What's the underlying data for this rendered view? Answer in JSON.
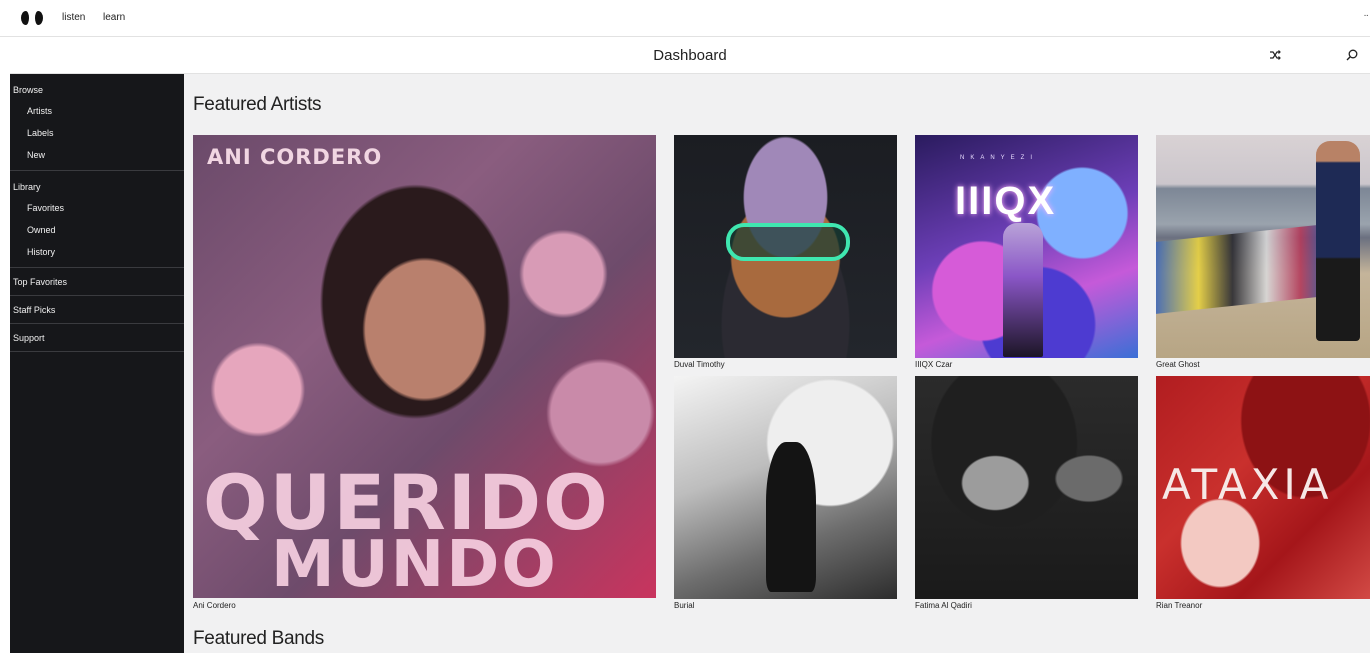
{
  "topbar": {
    "nav": [
      "listen",
      "learn"
    ],
    "more": "··"
  },
  "header": {
    "title": "Dashboard"
  },
  "sidebar": {
    "browse": {
      "label": "Browse",
      "items": [
        "Artists",
        "Labels",
        "New"
      ]
    },
    "library": {
      "label": "Library",
      "items": [
        "Favorites",
        "Owned",
        "History"
      ]
    },
    "top_favorites": "Top Favorites",
    "staff_picks": "Staff Picks",
    "support": "Support"
  },
  "main": {
    "featured_artists_title": "Featured Artists",
    "featured_bands_title": "Featured Bands",
    "artists": [
      {
        "name": "Ani Cordero",
        "art_text": "ANI CORDERO",
        "art_big_1": "QUERIDO",
        "art_big_2": "MUNDO"
      },
      {
        "name": "Duval Timothy"
      },
      {
        "name": "IIIQX Czar",
        "art_text": "IIIQX",
        "art_sub": "NKANYEZI"
      },
      {
        "name": "Great Ghost"
      },
      {
        "name": "Burial"
      },
      {
        "name": "Fatima Al Qadiri"
      },
      {
        "name": "Rian Treanor",
        "art_text": "ATAXIA"
      }
    ]
  },
  "icons": {
    "shuffle": "shuffle-icon",
    "search": "search-icon",
    "logo": "brand-logo"
  }
}
